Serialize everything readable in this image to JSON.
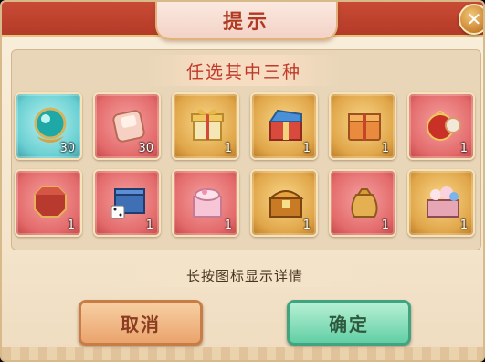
{
  "dialog": {
    "title": "提示",
    "close_symbol": "✕"
  },
  "banner": "任选其中三种",
  "items": [
    {
      "icon": "crystal-orb-icon",
      "style": "teal",
      "count": "30"
    },
    {
      "icon": "red-envelope-scroll-icon",
      "style": "red",
      "count": "30"
    },
    {
      "icon": "gold-gift-box-icon",
      "style": "gold",
      "count": "1"
    },
    {
      "icon": "blue-gift-chest-icon",
      "style": "gold",
      "count": "1"
    },
    {
      "icon": "orange-box-icon",
      "style": "gold",
      "count": "1"
    },
    {
      "icon": "red-lantern-pouch-icon",
      "style": "red",
      "count": "1"
    },
    {
      "icon": "red-octagon-box-icon",
      "style": "red",
      "count": "1"
    },
    {
      "icon": "blue-dice-box-icon",
      "style": "red",
      "count": "1"
    },
    {
      "icon": "pink-cake-box-icon",
      "style": "red",
      "count": "1"
    },
    {
      "icon": "golden-treasure-chest-icon",
      "style": "gold",
      "count": "1"
    },
    {
      "icon": "gold-coin-pouch-icon",
      "style": "red",
      "count": "1"
    },
    {
      "icon": "flower-jewel-chest-icon",
      "style": "gold",
      "count": "1"
    }
  ],
  "hint": "长按图标显示详情",
  "buttons": {
    "cancel": "取消",
    "confirm": "确定"
  },
  "colors": {
    "title_red": "#b03a22",
    "banner_red": "#c0392b",
    "cancel_bg": "#eaa46d",
    "confirm_bg": "#62cfa5"
  }
}
